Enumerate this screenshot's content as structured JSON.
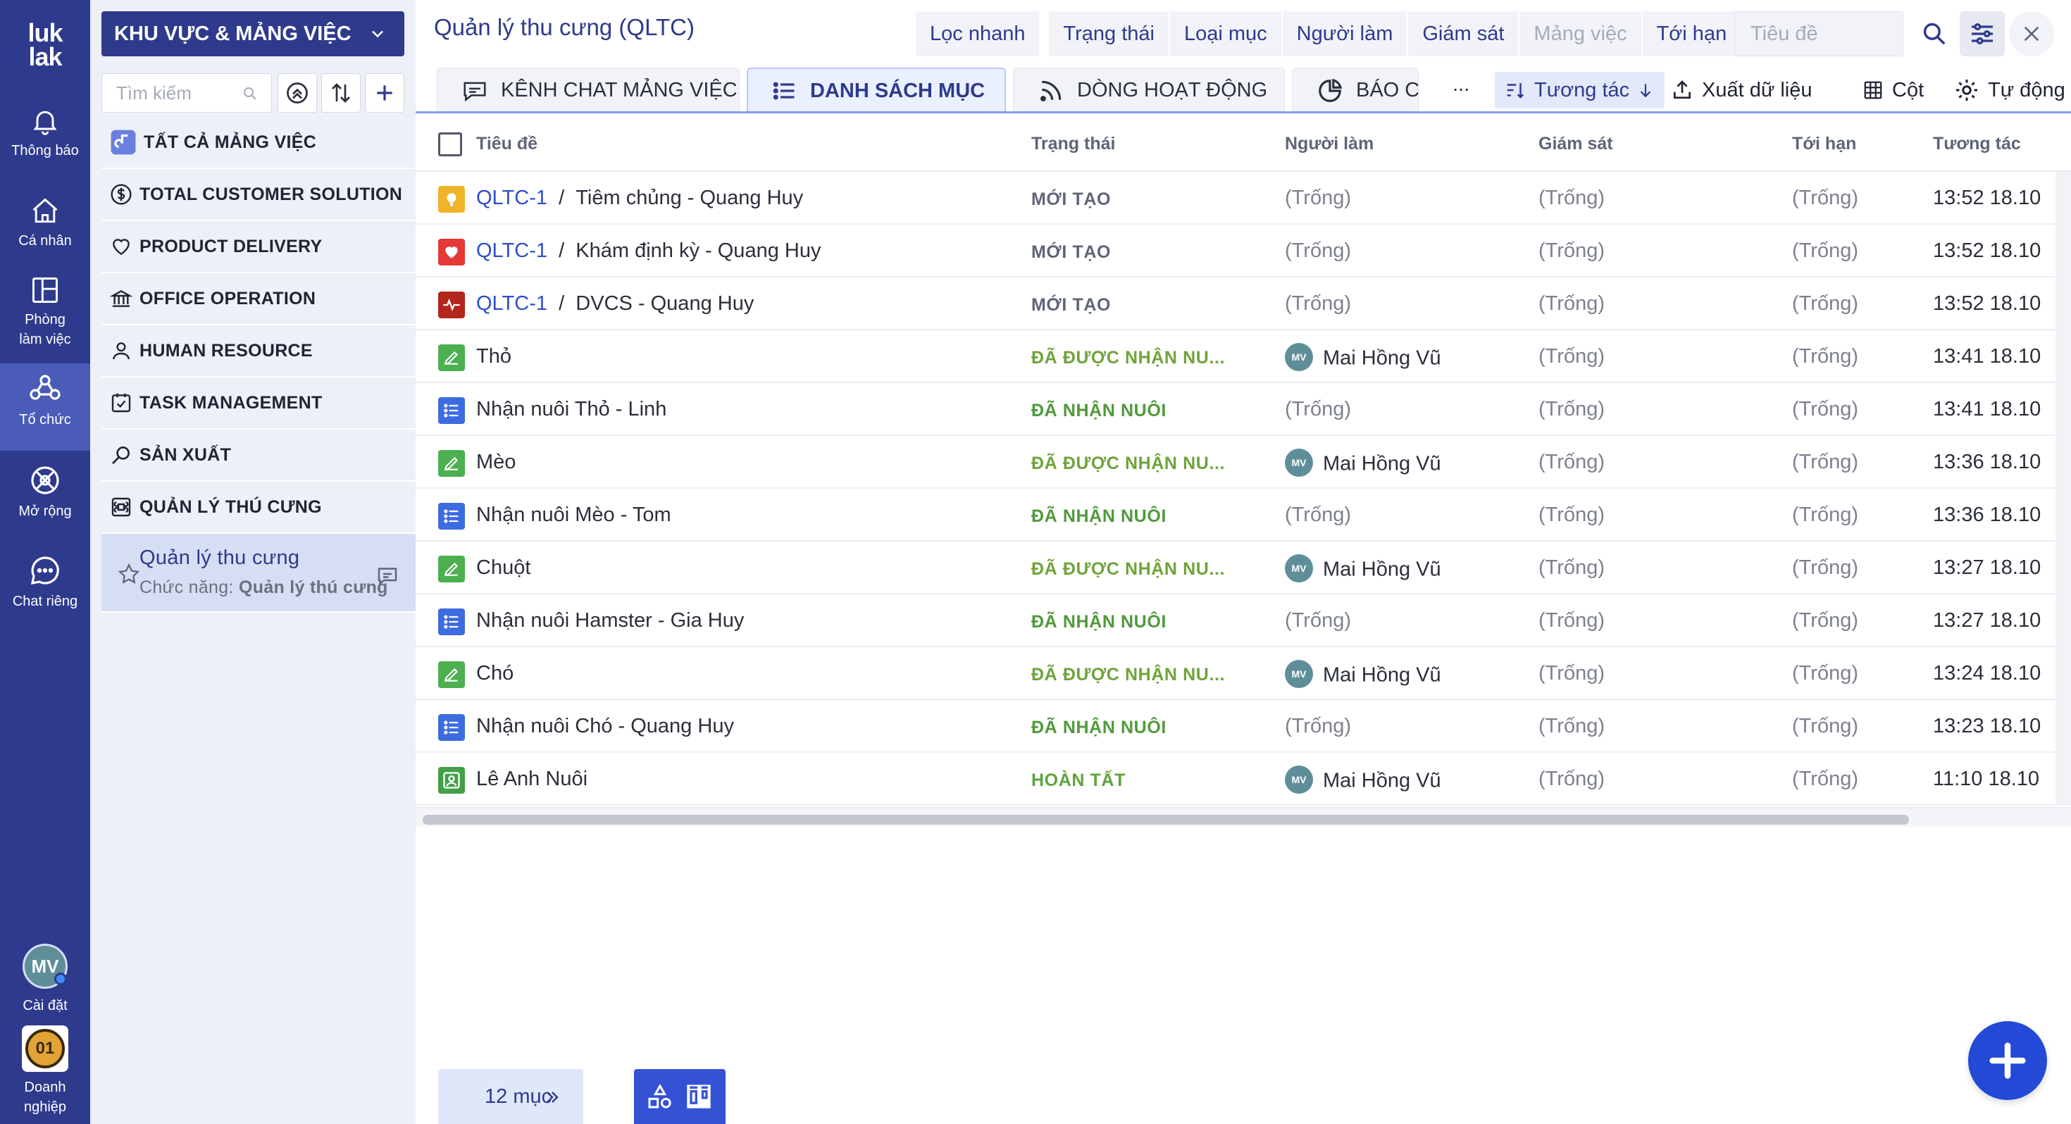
{
  "rail": {
    "logo_line1": "luk",
    "logo_line2": "lak",
    "items": [
      {
        "label": "Thông báo",
        "icon": "bell-icon"
      },
      {
        "label": "Cá nhân",
        "icon": "home-icon"
      },
      {
        "label": "Phòng làm việc",
        "icon": "layout-icon"
      },
      {
        "label": "Tổ chức",
        "icon": "organization-icon"
      },
      {
        "label": "Mở rộng",
        "icon": "extension-icon"
      },
      {
        "label": "Chat riêng",
        "icon": "chat-icon"
      }
    ],
    "user_initials": "MV",
    "settings_label": "Cài đặt",
    "business_badge": "01",
    "business_label": "Doanh nghiệp"
  },
  "sidebar": {
    "workspace_button": "KHU VỰC & MẢNG VIỆC",
    "search_placeholder": "Tìm kiếm",
    "items": [
      {
        "label": "TẤT CẢ MẢNG VIỆC",
        "icon": "all-workspaces-icon"
      },
      {
        "label": "TOTAL CUSTOMER SOLUTION",
        "icon": "dollar-icon"
      },
      {
        "label": "PRODUCT DELIVERY",
        "icon": "heart-icon"
      },
      {
        "label": "OFFICE OPERATION",
        "icon": "bank-icon"
      },
      {
        "label": "HUMAN RESOURCE",
        "icon": "person-icon"
      },
      {
        "label": "TASK MANAGEMENT",
        "icon": "checkbox-icon"
      },
      {
        "label": "SẢN XUẤT",
        "icon": "search-icon"
      },
      {
        "label": "QUẢN LÝ THÚ CƯNG",
        "icon": "command-icon"
      }
    ],
    "active": {
      "title": "Quản lý thu cưng",
      "subtitle_prefix": "Chức năng: ",
      "subtitle_value": "Quản lý thú cưng"
    }
  },
  "main": {
    "title": "Quản lý thu cưng (QLTC)",
    "filters": [
      "Lọc nhanh",
      "Trạng thái",
      "Loại mục",
      "Người làm",
      "Giám sát",
      "Mảng việc",
      "Tới hạn"
    ],
    "search_placeholder": "Tiêu đề",
    "tabs": [
      {
        "label": "KÊNH CHAT MẢNG VIỆC",
        "icon": "chat-channel-icon"
      },
      {
        "label": "DANH SÁCH MỤC",
        "icon": "list-icon"
      },
      {
        "label": "DÒNG HOẠT ĐỘNG",
        "icon": "activity-feed-icon"
      },
      {
        "label": "BÁO C",
        "icon": "pie-chart-icon"
      }
    ],
    "more_tabs": "...",
    "toolbar": {
      "sort_label": "Tương tác",
      "export_label": "Xuất dữ liệu",
      "columns_label": "Cột",
      "auto_label": "Tự động"
    },
    "columns": [
      "Tiêu đề",
      "Trạng thái",
      "Người làm",
      "Giám sát",
      "Tới hạn",
      "Tương tác"
    ],
    "rows": [
      {
        "icon": "vaccine-icon",
        "icon_bg": "#f0b429",
        "code": "QLTC-1",
        "title": "Tiêm chủng - Quang Huy",
        "status": "MỚI TẠO",
        "status_class": "st-new",
        "assignee": "(Trống)",
        "avatar": "",
        "supervisor": "(Trống)",
        "due": "(Trống)",
        "time": "13:52 18.10"
      },
      {
        "icon": "health-check-icon",
        "icon_bg": "#e53935",
        "code": "QLTC-1",
        "title": "Khám định kỳ - Quang Huy",
        "status": "MỚI TẠO",
        "status_class": "st-new",
        "assignee": "(Trống)",
        "avatar": "",
        "supervisor": "(Trống)",
        "due": "(Trống)",
        "time": "13:52 18.10"
      },
      {
        "icon": "heartbeat-icon",
        "icon_bg": "#b3261e",
        "code": "QLTC-1",
        "title": "DVCS - Quang Huy",
        "status": "MỚI TẠO",
        "status_class": "st-new",
        "assignee": "(Trống)",
        "avatar": "",
        "supervisor": "(Trống)",
        "due": "(Trống)",
        "time": "13:52 18.10"
      },
      {
        "icon": "pencil-icon",
        "icon_bg": "#4caf50",
        "code": "",
        "title": "Thỏ",
        "status": "ĐÃ ĐƯỢC NHẬN NU...",
        "status_class": "st-green",
        "assignee": "Mai Hồng Vũ",
        "avatar": "MV",
        "supervisor": "(Trống)",
        "due": "(Trống)",
        "time": "13:41 18.10"
      },
      {
        "icon": "list-item-icon",
        "icon_bg": "#3d6be0",
        "code": "",
        "title": "Nhận nuôi Thỏ - Linh",
        "status": "ĐÃ NHẬN NUÔI",
        "status_class": "st-adopt",
        "assignee": "(Trống)",
        "avatar": "",
        "supervisor": "(Trống)",
        "due": "(Trống)",
        "time": "13:41 18.10"
      },
      {
        "icon": "pencil-icon",
        "icon_bg": "#4caf50",
        "code": "",
        "title": "Mèo",
        "status": "ĐÃ ĐƯỢC NHẬN NU...",
        "status_class": "st-green",
        "assignee": "Mai Hồng Vũ",
        "avatar": "MV",
        "supervisor": "(Trống)",
        "due": "(Trống)",
        "time": "13:36 18.10"
      },
      {
        "icon": "list-item-icon",
        "icon_bg": "#3d6be0",
        "code": "",
        "title": "Nhận nuôi Mèo - Tom",
        "status": "ĐÃ NHẬN NUÔI",
        "status_class": "st-adopt",
        "assignee": "(Trống)",
        "avatar": "",
        "supervisor": "(Trống)",
        "due": "(Trống)",
        "time": "13:36 18.10"
      },
      {
        "icon": "pencil-icon",
        "icon_bg": "#4caf50",
        "code": "",
        "title": "Chuột",
        "status": "ĐÃ ĐƯỢC NHẬN NU...",
        "status_class": "st-green",
        "assignee": "Mai Hồng Vũ",
        "avatar": "MV",
        "supervisor": "(Trống)",
        "due": "(Trống)",
        "time": "13:27 18.10"
      },
      {
        "icon": "list-item-icon",
        "icon_bg": "#3d6be0",
        "code": "",
        "title": "Nhận nuôi Hamster - Gia Huy",
        "status": "ĐÃ NHẬN NUÔI",
        "status_class": "st-adopt",
        "assignee": "(Trống)",
        "avatar": "",
        "supervisor": "(Trống)",
        "due": "(Trống)",
        "time": "13:27 18.10"
      },
      {
        "icon": "pencil-icon",
        "icon_bg": "#4caf50",
        "code": "",
        "title": "Chó",
        "status": "ĐÃ ĐƯỢC NHẬN NU...",
        "status_class": "st-green",
        "assignee": "Mai Hồng Vũ",
        "avatar": "MV",
        "supervisor": "(Trống)",
        "due": "(Trống)",
        "time": "13:24 18.10"
      },
      {
        "icon": "list-item-icon",
        "icon_bg": "#3d6be0",
        "code": "",
        "title": "Nhận nuôi Chó - Quang Huy",
        "status": "ĐÃ NHẬN NUÔI",
        "status_class": "st-adopt",
        "assignee": "(Trống)",
        "avatar": "",
        "supervisor": "(Trống)",
        "due": "(Trống)",
        "time": "13:23 18.10"
      },
      {
        "icon": "contact-icon",
        "icon_bg": "#43a047",
        "code": "",
        "title": "Lê Anh Nuôi",
        "status": "HOÀN TẤT",
        "status_class": "st-done",
        "assignee": "Mai Hồng Vũ",
        "avatar": "MV",
        "supervisor": "(Trống)",
        "due": "(Trống)",
        "time": "11:10 18.10"
      }
    ],
    "item_count": "12 mục"
  },
  "colors": {
    "brand": "#2e3a8c",
    "accent": "#2349d6",
    "link": "#2e4fc7"
  }
}
